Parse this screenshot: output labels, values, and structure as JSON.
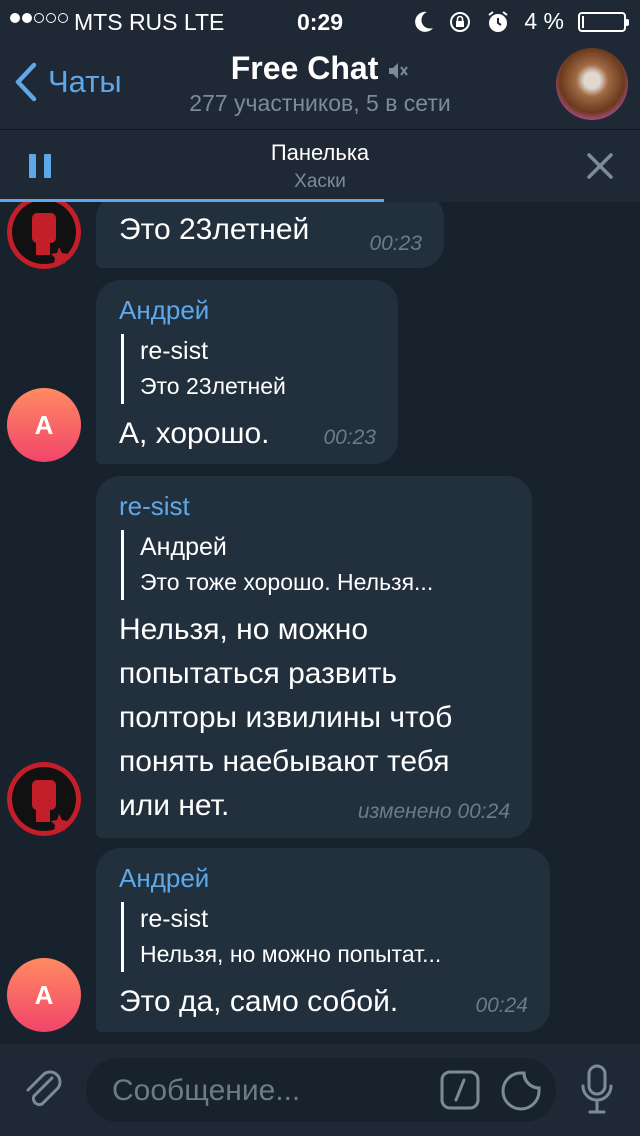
{
  "status_bar": {
    "signal_bars": 5,
    "signal_filled": 2,
    "carrier": "MTS RUS   LTE",
    "time": "0:29",
    "battery_text": "4 %",
    "battery_level": 0.04,
    "icons": [
      "moon-icon",
      "rotation-lock-icon",
      "alarm-icon"
    ]
  },
  "header": {
    "back_label": "Чаты",
    "title": "Free Chat",
    "subtitle": "277 участников, 5 в сети",
    "muted_icon": "speaker-muted-icon"
  },
  "pinned": {
    "title": "Панелька",
    "subtitle": "Хаски",
    "progress": 0.6
  },
  "messages": [
    {
      "text": "Это 23летней",
      "time": "00:23",
      "avatar": "fist-logo"
    },
    {
      "sender": "Андрей",
      "reply_name": "re-sist",
      "reply_text": "Это 23летней",
      "text": "А, хорошо.",
      "time": "00:23",
      "avatar_letter": "A"
    },
    {
      "sender": "re-sist",
      "reply_name": "Андрей",
      "reply_text": "Это тоже хорошо. Нельзя...",
      "text": "Нельзя, но можно попытаться развить полторы извилины чтоб понять наебывают тебя или нет.",
      "time": "изменено 00:24",
      "avatar": "fist-logo"
    },
    {
      "sender": "Андрей",
      "reply_name": "re-sist",
      "reply_text": "Нельзя, но можно попытат...",
      "text": "Это да, само собой.",
      "time": "00:24",
      "avatar_letter": "A"
    }
  ],
  "input": {
    "placeholder": "Сообщение..."
  },
  "colors": {
    "background": "#18222d",
    "bar": "#1f2936",
    "bubble": "#222f3c",
    "accent": "#5ea8ea",
    "avatar_gradient_top": "#ff8a62",
    "avatar_gradient_bottom": "#f1456a"
  }
}
